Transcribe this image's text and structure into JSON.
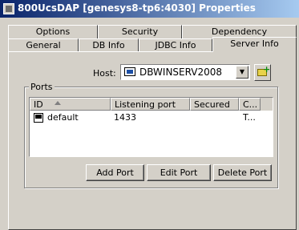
{
  "window": {
    "title": "800UcsDAP [genesys8-tp6:4030] Properties"
  },
  "tabs": {
    "row_back": [
      "Options",
      "Security",
      "Dependency"
    ],
    "row_front": [
      "General",
      "DB Info",
      "JDBC Info",
      "Server Info"
    ],
    "active": "Server Info"
  },
  "host": {
    "label": "Host:",
    "value": "DBWINSERV2008"
  },
  "ports": {
    "legend": "Ports",
    "columns": [
      "ID",
      "Listening port",
      "Secured",
      "C..."
    ],
    "rows": [
      {
        "id": "default",
        "listening_port": "1433",
        "secured": "",
        "c": "T..."
      }
    ]
  },
  "buttons": {
    "add": "Add Port",
    "edit": "Edit Port",
    "delete": "Delete Port"
  }
}
